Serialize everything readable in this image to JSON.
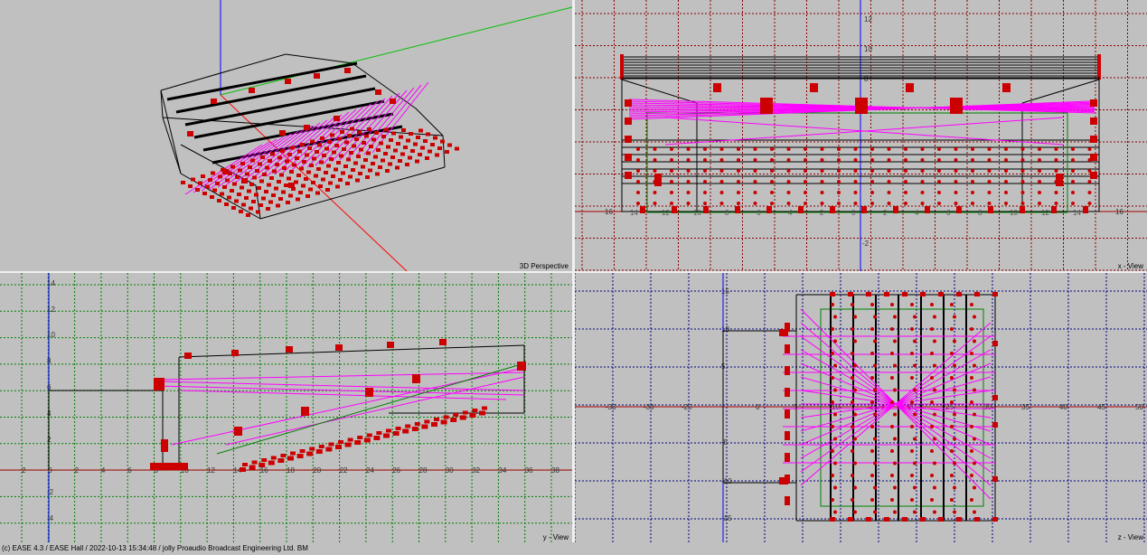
{
  "views": {
    "perspective": {
      "label": "3D Perspective"
    },
    "x_view": {
      "label": "x - View",
      "ticks_top": [
        "12",
        "10",
        "8"
      ],
      "tick_bottom": "-2",
      "side_left": "16",
      "side_right": "16",
      "bottom_row": [
        "14",
        "12",
        "10",
        "8",
        "6",
        "4",
        "2",
        "0",
        "2",
        "4",
        "6",
        "8",
        "10",
        "12",
        "14"
      ]
    },
    "y_view": {
      "label": "y - View",
      "y_ticks": [
        "14",
        "12",
        "10",
        "8",
        "6",
        "4",
        "2",
        "-2",
        "-4"
      ],
      "x_ticks": [
        "2",
        "0",
        "2",
        "4",
        "6",
        "8",
        "10",
        "12",
        "14",
        "16",
        "18",
        "20",
        "22",
        "24",
        "26",
        "28",
        "30",
        "32",
        "34",
        "36",
        "38"
      ]
    },
    "z_view": {
      "label": "z - View",
      "y_ticks": [
        "15",
        "10",
        "5",
        "-5",
        "-10",
        "-15"
      ],
      "x_ticks": [
        "-35",
        "-30",
        "-25",
        "0",
        "5",
        "10",
        "15",
        "20",
        "25",
        "30",
        "35",
        "40",
        "45",
        "50",
        "55"
      ]
    }
  },
  "status_bar": "(c) EASE 4.3  / EASE Hall  / 2022-10-13 15:34:48 / jolly Proaudio Broadcast Engineering Ltd. BM",
  "colors": {
    "background": "#c0c0c0",
    "marker": "#cc0000",
    "beam": "#ff00ff",
    "wire": "#000000"
  }
}
